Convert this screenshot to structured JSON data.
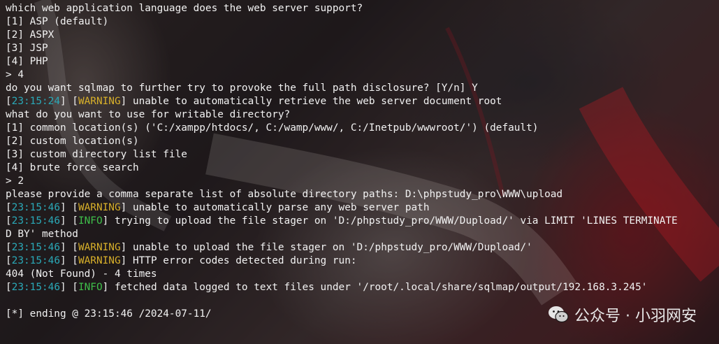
{
  "terminal": {
    "lines": [
      [
        {
          "t": "which web application language does the web server support?"
        }
      ],
      [
        {
          "t": "[1] ASP (default)"
        }
      ],
      [
        {
          "t": "[2] ASPX"
        }
      ],
      [
        {
          "t": "[3] JSP"
        }
      ],
      [
        {
          "t": "[4] PHP"
        }
      ],
      [
        {
          "t": "> 4"
        }
      ],
      [
        {
          "t": "do you want sqlmap to further try to provoke the full path disclosure? [Y/n] Y"
        }
      ],
      [
        {
          "t": "["
        },
        {
          "t": "23:15:24",
          "c": "ts"
        },
        {
          "t": "] ["
        },
        {
          "t": "WARNING",
          "c": "warn"
        },
        {
          "t": "] unable to automatically retrieve the web server document root"
        }
      ],
      [
        {
          "t": "what do you want to use for writable directory?"
        }
      ],
      [
        {
          "t": "[1] common location(s) ('C:/xampp/htdocs/, C:/wamp/www/, C:/Inetpub/wwwroot/') (default)"
        }
      ],
      [
        {
          "t": "[2] custom location(s)"
        }
      ],
      [
        {
          "t": "[3] custom directory list file"
        }
      ],
      [
        {
          "t": "[4] brute force search"
        }
      ],
      [
        {
          "t": "> 2"
        }
      ],
      [
        {
          "t": "please provide a comma separate list of absolute directory paths: D:\\phpstudy_pro\\WWW\\upload"
        }
      ],
      [
        {
          "t": "["
        },
        {
          "t": "23:15:46",
          "c": "ts"
        },
        {
          "t": "] ["
        },
        {
          "t": "WARNING",
          "c": "warn"
        },
        {
          "t": "] unable to automatically parse any web server path"
        }
      ],
      [
        {
          "t": "["
        },
        {
          "t": "23:15:46",
          "c": "ts"
        },
        {
          "t": "] ["
        },
        {
          "t": "INFO",
          "c": "info"
        },
        {
          "t": "] trying to upload the file stager on 'D:/phpstudy_pro/WWW/Dupload/' via LIMIT 'LINES TERMINATE"
        }
      ],
      [
        {
          "t": "D BY' method"
        }
      ],
      [
        {
          "t": "["
        },
        {
          "t": "23:15:46",
          "c": "ts"
        },
        {
          "t": "] ["
        },
        {
          "t": "WARNING",
          "c": "warn"
        },
        {
          "t": "] unable to upload the file stager on 'D:/phpstudy_pro/WWW/Dupload/'"
        }
      ],
      [
        {
          "t": "["
        },
        {
          "t": "23:15:46",
          "c": "ts"
        },
        {
          "t": "] ["
        },
        {
          "t": "WARNING",
          "c": "warn"
        },
        {
          "t": "] HTTP error codes detected during run:"
        }
      ],
      [
        {
          "t": "404 (Not Found) - 4 times"
        }
      ],
      [
        {
          "t": "["
        },
        {
          "t": "23:15:46",
          "c": "ts"
        },
        {
          "t": "] ["
        },
        {
          "t": "INFO",
          "c": "info"
        },
        {
          "t": "] fetched data logged to text files under '/root/.local/share/sqlmap/output/192.168.3.245'"
        }
      ],
      [
        {
          "t": ""
        }
      ],
      [
        {
          "t": "[*] ending @ 23:15:46 /2024-07-11/"
        }
      ]
    ]
  },
  "watermark": {
    "text": "公众号 · 小羽网安",
    "icon": "wechat-icon"
  },
  "colors": {
    "timestamp": "#2aa9b8",
    "warning": "#d8b02a",
    "info": "#3fbf4a",
    "text": "#f2f2f2"
  }
}
